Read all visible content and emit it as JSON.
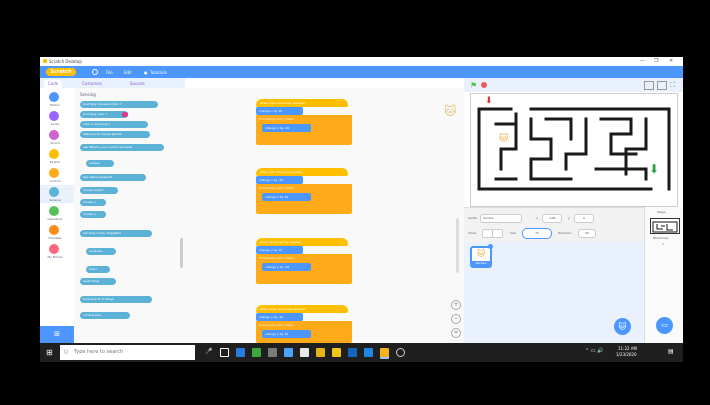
{
  "window": {
    "title": "Scratch Desktop",
    "controls": [
      "—",
      "❐",
      "✕"
    ]
  },
  "menubar": {
    "logo": "Scratch",
    "items": [
      "File",
      "Edit",
      "Tutorials"
    ],
    "icon": "globe-icon"
  },
  "tabs": [
    "Code",
    "Costumes",
    "Sounds"
  ],
  "categories": [
    {
      "label": "Motion",
      "color": "#4c97ff"
    },
    {
      "label": "Looks",
      "color": "#9966ff"
    },
    {
      "label": "Sound",
      "color": "#cf63cf"
    },
    {
      "label": "Events",
      "color": "#ffbf00"
    },
    {
      "label": "Control",
      "color": "#ffab19"
    },
    {
      "label": "Sensing",
      "color": "#5cb1d6"
    },
    {
      "label": "Operators",
      "color": "#59c059"
    },
    {
      "label": "Variables",
      "color": "#ff8c1a"
    },
    {
      "label": "My Blocks",
      "color": "#ff6680"
    }
  ],
  "palette": {
    "heading": "Sensing",
    "blocks": [
      "touching mouse-pointer ?",
      "touching color ?",
      "color is touching ?",
      "distance to mouse-pointer",
      "ask What's your name? and wait",
      "answer",
      "key space pressed?",
      "mouse down?",
      "mouse x",
      "mouse y",
      "set drag mode draggable",
      "loudness",
      "timer",
      "reset timer",
      "backdrop # of Stage",
      "current year"
    ]
  },
  "scripts": [
    {
      "hat": "when right arrow key pressed",
      "move": "change x by 10",
      "if": "if touching color ? then",
      "inner": "change x by -10"
    },
    {
      "hat": "when left arrow key pressed",
      "move": "change x by -10",
      "if": "if touching color ? then",
      "inner": "change x by 10"
    },
    {
      "hat": "when up arrow key pressed",
      "move": "change y by 10",
      "if": "if touching color ? then",
      "inner": "change y by -10"
    },
    {
      "hat": "when down arrow key pressed",
      "move": "change y by -10",
      "if": "if touching color ? then",
      "inner": "change y by 10"
    }
  ],
  "sprite_info": {
    "sprite_label": "Sprite",
    "sprite_name": "Sprite1",
    "x_label": "x",
    "x_value": "-208",
    "y_label": "y",
    "y_value": "0",
    "show_label": "Show",
    "size_label": "Size",
    "size_value": "15",
    "direction_label": "Direction",
    "direction_value": "90"
  },
  "sprite_tile": {
    "name": "Sprite1"
  },
  "stage_pane": {
    "label": "Stage",
    "backdrops_label": "Backdrops",
    "backdrops_count": "1"
  },
  "taskbar": {
    "search_placeholder": "Type here to search",
    "time": "11:22 AM",
    "date": "1/23/2020"
  },
  "colors": {
    "scratch_blue": "#4c97ff",
    "event_yellow": "#ffbf00",
    "control_orange": "#ffab19",
    "maze_wall": "#1a1a1a",
    "flag_green": "#4cbf56"
  }
}
